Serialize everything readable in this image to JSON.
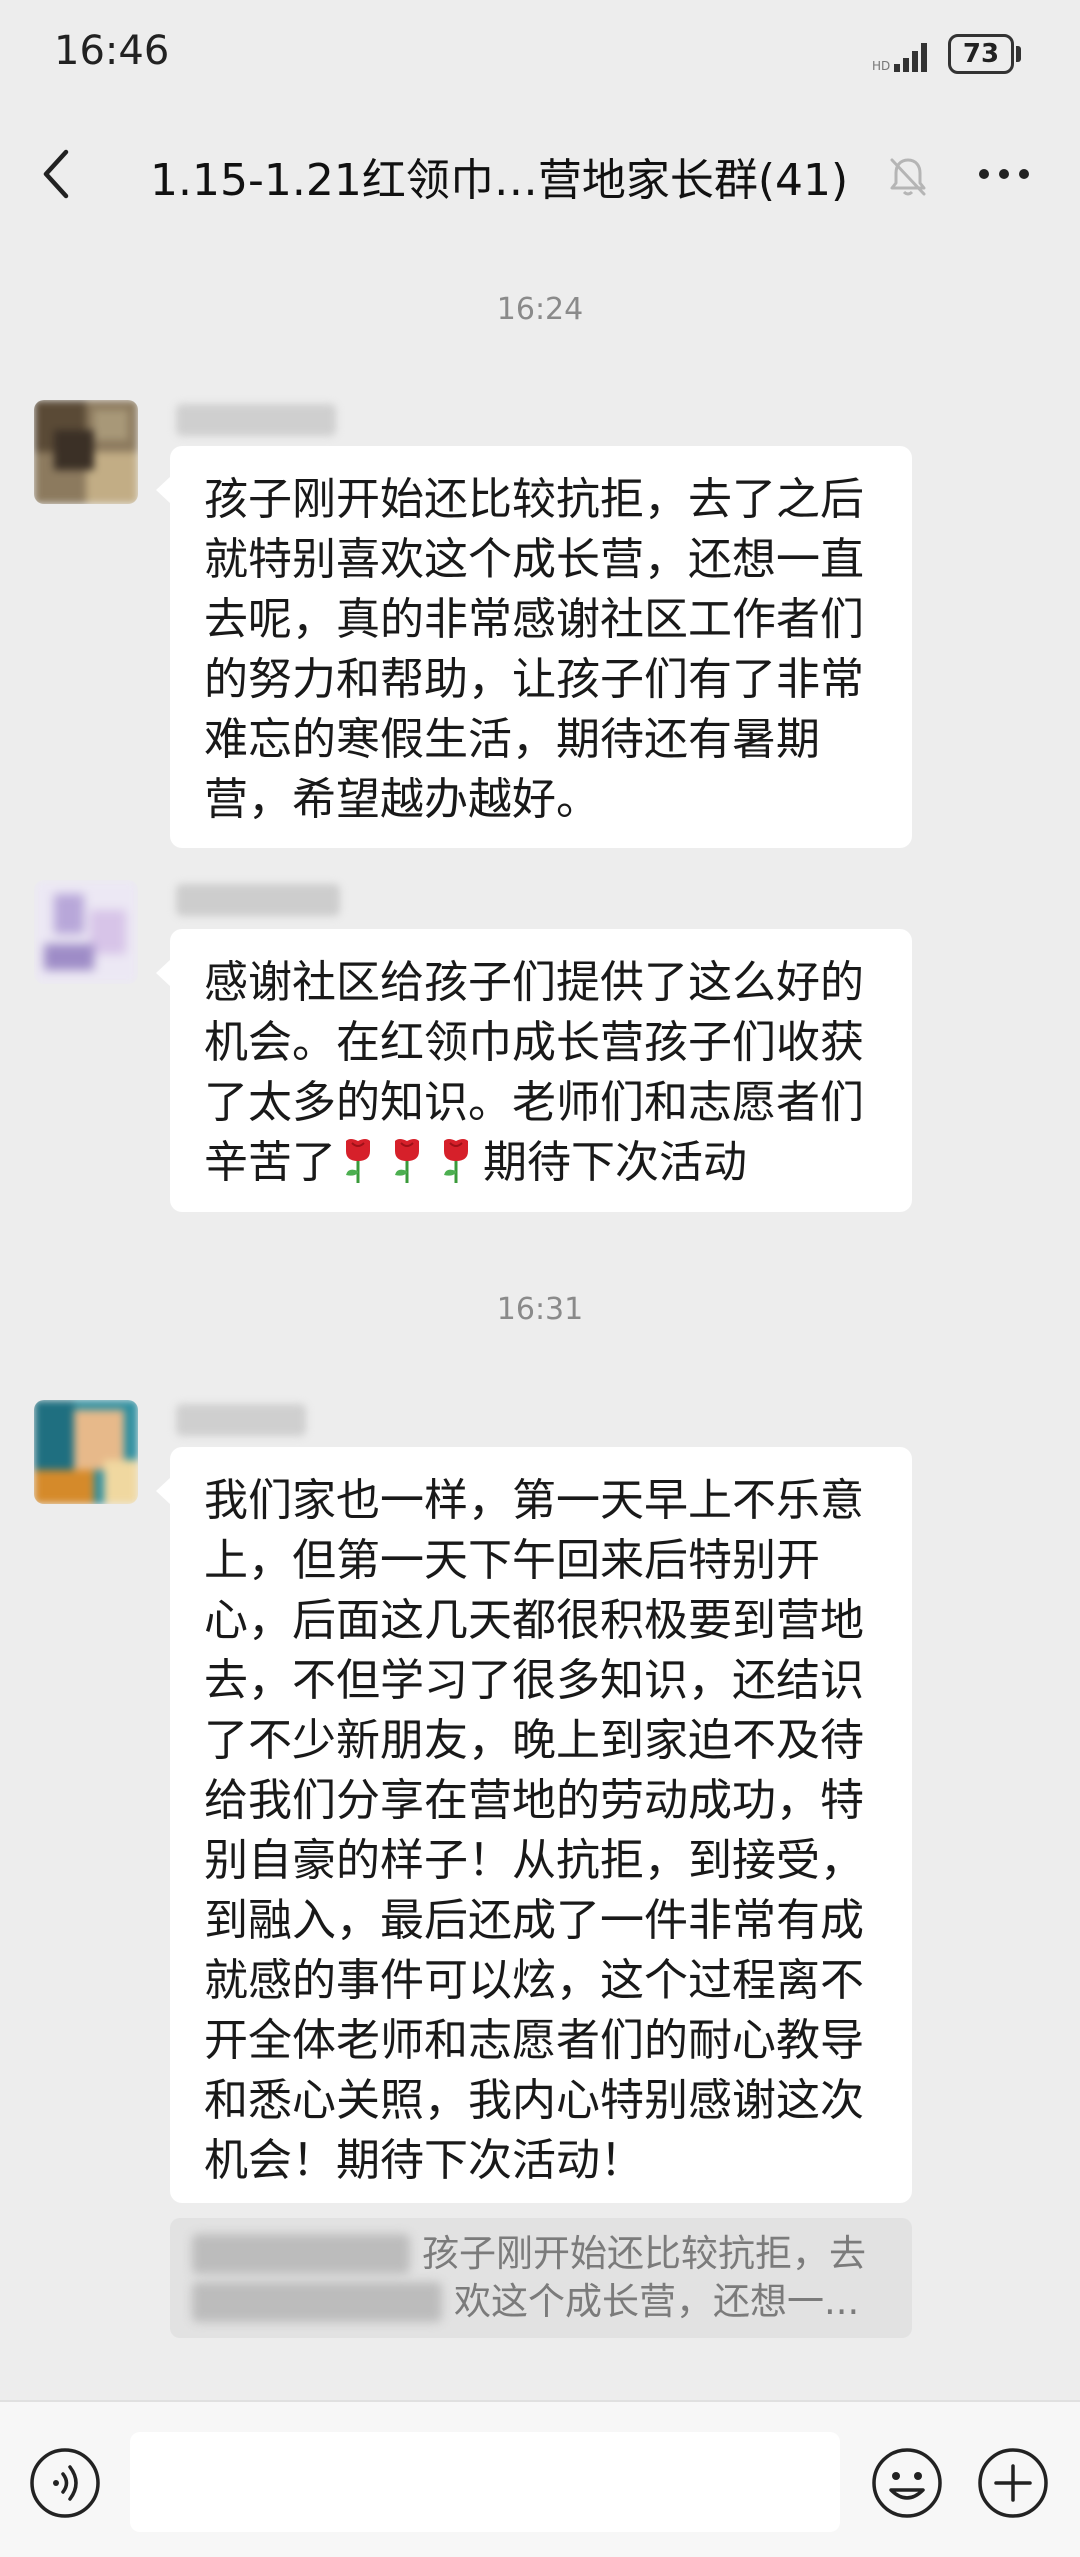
{
  "status_bar": {
    "time": "16:46",
    "battery": "73"
  },
  "header": {
    "title": "1.15-1.21红领巾…营地家长群(41)"
  },
  "messages": [
    {
      "timestamp": "16:24",
      "text": "孩子刚开始还比较抗拒，去了之后就特别喜欢这个成长营，还想一直去呢，真的非常感谢社区工作者们的努力和帮助，让孩子们有了非常难忘的寒假生活，期待还有暑期营，希望越办越好。"
    },
    {
      "text_before_emoji": "感谢社区给孩子们提供了这么好的机会。在红领巾成长营孩子们收获了太多的知识。老师们和志愿者们辛苦了",
      "emoji": "rose-emoji",
      "text_after_emoji": "期待下次活动"
    },
    {
      "timestamp": "16:31",
      "text": "我们家也一样，第一天早上不乐意上，但第一天下午回来后特别开心，后面这几天都很积极要到营地去，不但学习了很多知识，还结识了不少新朋友，晚上到家迫不及待给我们分享在营地的劳动成功，特别自豪的样子！从抗拒，到接受，到融入，最后还成了一件非常有成就感的事件可以炫，这个过程离不开全体老师和志愿者们的耐心教导和悉心关照，我内心特别感谢这次机会！期待下次活动！",
      "quote_line_1": "孩子刚开始还比较抗拒，去",
      "quote_line_2": "欢这个成长营，还想一..."
    }
  ],
  "icons": {
    "back": "back-arrow-icon",
    "mute": "mute-bell-icon",
    "more": "more-dots-icon",
    "voice": "voice-input-icon",
    "emoji": "emoji-icon",
    "plus": "plus-icon"
  }
}
